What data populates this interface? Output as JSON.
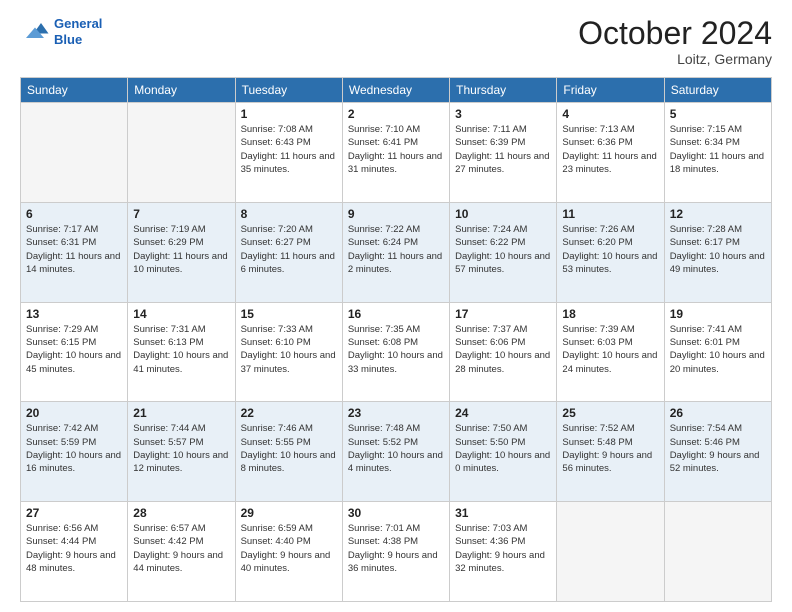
{
  "header": {
    "logo_line1": "General",
    "logo_line2": "Blue",
    "month_title": "October 2024",
    "location": "Loitz, Germany"
  },
  "days_of_week": [
    "Sunday",
    "Monday",
    "Tuesday",
    "Wednesday",
    "Thursday",
    "Friday",
    "Saturday"
  ],
  "weeks": [
    [
      {
        "day": "",
        "info": ""
      },
      {
        "day": "",
        "info": ""
      },
      {
        "day": "1",
        "info": "Sunrise: 7:08 AM\nSunset: 6:43 PM\nDaylight: 11 hours and 35 minutes."
      },
      {
        "day": "2",
        "info": "Sunrise: 7:10 AM\nSunset: 6:41 PM\nDaylight: 11 hours and 31 minutes."
      },
      {
        "day": "3",
        "info": "Sunrise: 7:11 AM\nSunset: 6:39 PM\nDaylight: 11 hours and 27 minutes."
      },
      {
        "day": "4",
        "info": "Sunrise: 7:13 AM\nSunset: 6:36 PM\nDaylight: 11 hours and 23 minutes."
      },
      {
        "day": "5",
        "info": "Sunrise: 7:15 AM\nSunset: 6:34 PM\nDaylight: 11 hours and 18 minutes."
      }
    ],
    [
      {
        "day": "6",
        "info": "Sunrise: 7:17 AM\nSunset: 6:31 PM\nDaylight: 11 hours and 14 minutes."
      },
      {
        "day": "7",
        "info": "Sunrise: 7:19 AM\nSunset: 6:29 PM\nDaylight: 11 hours and 10 minutes."
      },
      {
        "day": "8",
        "info": "Sunrise: 7:20 AM\nSunset: 6:27 PM\nDaylight: 11 hours and 6 minutes."
      },
      {
        "day": "9",
        "info": "Sunrise: 7:22 AM\nSunset: 6:24 PM\nDaylight: 11 hours and 2 minutes."
      },
      {
        "day": "10",
        "info": "Sunrise: 7:24 AM\nSunset: 6:22 PM\nDaylight: 10 hours and 57 minutes."
      },
      {
        "day": "11",
        "info": "Sunrise: 7:26 AM\nSunset: 6:20 PM\nDaylight: 10 hours and 53 minutes."
      },
      {
        "day": "12",
        "info": "Sunrise: 7:28 AM\nSunset: 6:17 PM\nDaylight: 10 hours and 49 minutes."
      }
    ],
    [
      {
        "day": "13",
        "info": "Sunrise: 7:29 AM\nSunset: 6:15 PM\nDaylight: 10 hours and 45 minutes."
      },
      {
        "day": "14",
        "info": "Sunrise: 7:31 AM\nSunset: 6:13 PM\nDaylight: 10 hours and 41 minutes."
      },
      {
        "day": "15",
        "info": "Sunrise: 7:33 AM\nSunset: 6:10 PM\nDaylight: 10 hours and 37 minutes."
      },
      {
        "day": "16",
        "info": "Sunrise: 7:35 AM\nSunset: 6:08 PM\nDaylight: 10 hours and 33 minutes."
      },
      {
        "day": "17",
        "info": "Sunrise: 7:37 AM\nSunset: 6:06 PM\nDaylight: 10 hours and 28 minutes."
      },
      {
        "day": "18",
        "info": "Sunrise: 7:39 AM\nSunset: 6:03 PM\nDaylight: 10 hours and 24 minutes."
      },
      {
        "day": "19",
        "info": "Sunrise: 7:41 AM\nSunset: 6:01 PM\nDaylight: 10 hours and 20 minutes."
      }
    ],
    [
      {
        "day": "20",
        "info": "Sunrise: 7:42 AM\nSunset: 5:59 PM\nDaylight: 10 hours and 16 minutes."
      },
      {
        "day": "21",
        "info": "Sunrise: 7:44 AM\nSunset: 5:57 PM\nDaylight: 10 hours and 12 minutes."
      },
      {
        "day": "22",
        "info": "Sunrise: 7:46 AM\nSunset: 5:55 PM\nDaylight: 10 hours and 8 minutes."
      },
      {
        "day": "23",
        "info": "Sunrise: 7:48 AM\nSunset: 5:52 PM\nDaylight: 10 hours and 4 minutes."
      },
      {
        "day": "24",
        "info": "Sunrise: 7:50 AM\nSunset: 5:50 PM\nDaylight: 10 hours and 0 minutes."
      },
      {
        "day": "25",
        "info": "Sunrise: 7:52 AM\nSunset: 5:48 PM\nDaylight: 9 hours and 56 minutes."
      },
      {
        "day": "26",
        "info": "Sunrise: 7:54 AM\nSunset: 5:46 PM\nDaylight: 9 hours and 52 minutes."
      }
    ],
    [
      {
        "day": "27",
        "info": "Sunrise: 6:56 AM\nSunset: 4:44 PM\nDaylight: 9 hours and 48 minutes."
      },
      {
        "day": "28",
        "info": "Sunrise: 6:57 AM\nSunset: 4:42 PM\nDaylight: 9 hours and 44 minutes."
      },
      {
        "day": "29",
        "info": "Sunrise: 6:59 AM\nSunset: 4:40 PM\nDaylight: 9 hours and 40 minutes."
      },
      {
        "day": "30",
        "info": "Sunrise: 7:01 AM\nSunset: 4:38 PM\nDaylight: 9 hours and 36 minutes."
      },
      {
        "day": "31",
        "info": "Sunrise: 7:03 AM\nSunset: 4:36 PM\nDaylight: 9 hours and 32 minutes."
      },
      {
        "day": "",
        "info": ""
      },
      {
        "day": "",
        "info": ""
      }
    ]
  ]
}
